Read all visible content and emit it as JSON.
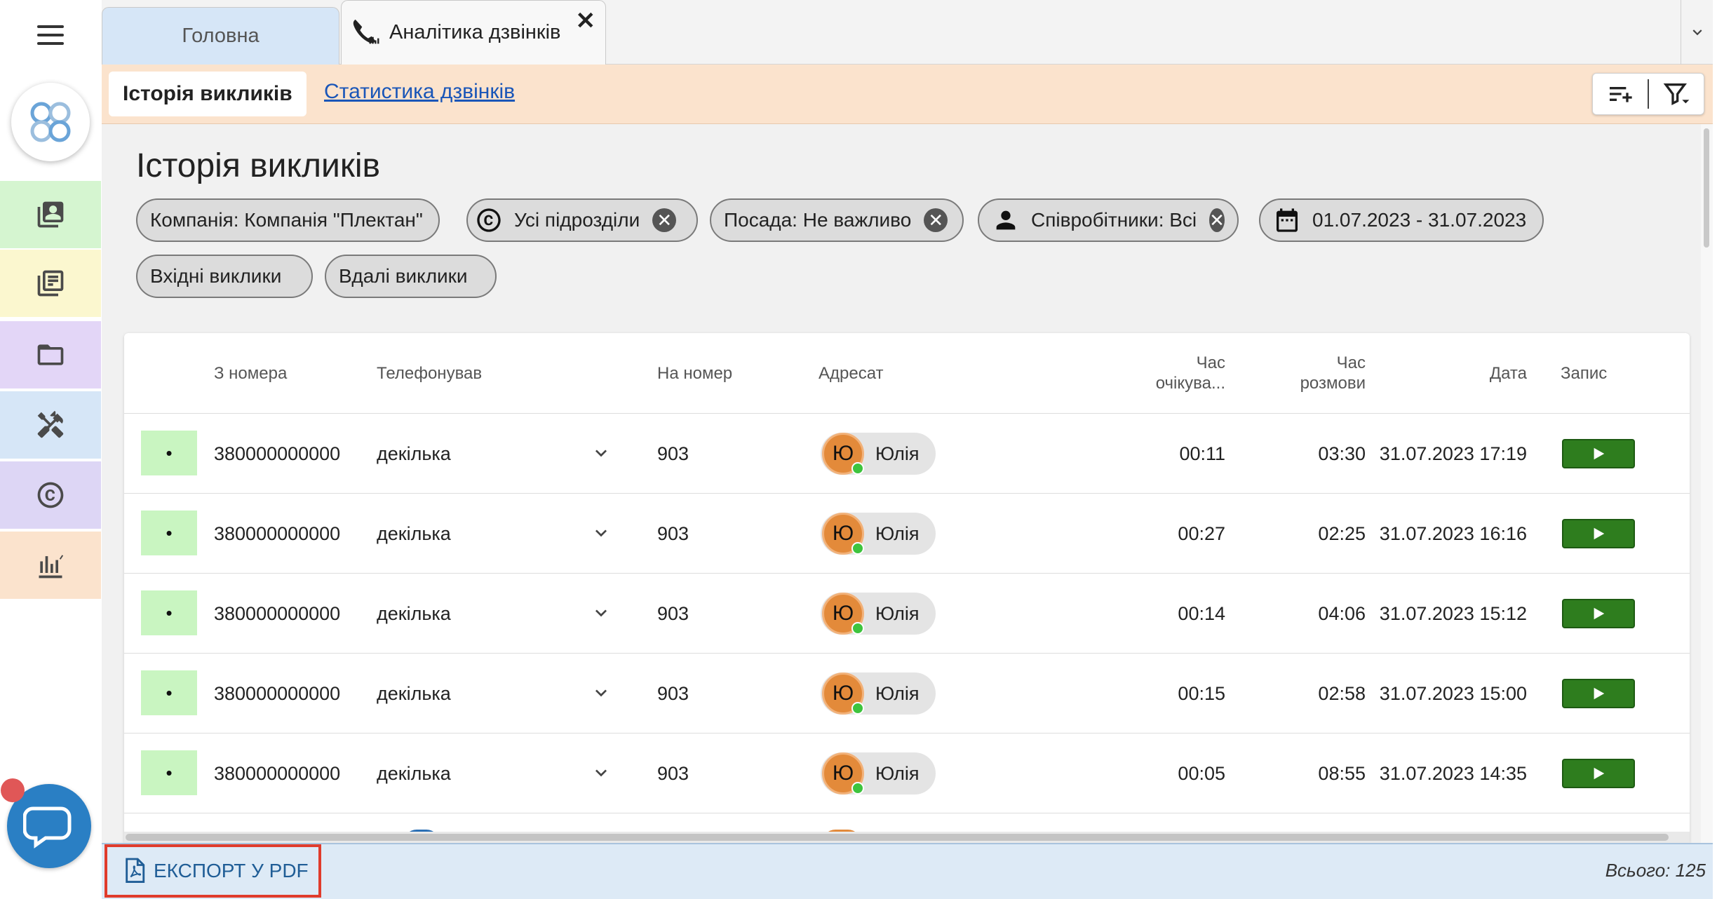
{
  "tabs": {
    "home_label": "Головна",
    "active_label": "Аналітика дзвінків",
    "close_symbol": "✕"
  },
  "subnav": {
    "active_label": "Історія викликів",
    "link_label": "Статистика дзвінків"
  },
  "page": {
    "title": "Історія викликів"
  },
  "chips": {
    "company": "Компанія: Компанія \"Плектан\"",
    "departments": "Усі підрозділи",
    "position": "Посада: Не важливо",
    "employees": "Співробітники: Всі",
    "date_range": "01.07.2023 - 31.07.2023",
    "incoming": "Вхідні виклики",
    "successful": "Вдалі виклики",
    "clear_symbol": "✕"
  },
  "table": {
    "headers": {
      "from_number": "З номера",
      "caller": "Телефонував",
      "to_number": "На номер",
      "addressee": "Адресат",
      "wait_time_line1": "Час",
      "wait_time_line2": "очікува...",
      "talk_time_line1": "Час",
      "talk_time_line2": "розмови",
      "date": "Дата",
      "record": "Запис"
    },
    "rows": [
      {
        "status": "•",
        "from": "380000000000",
        "caller": "декілька",
        "to": "903",
        "avatar": "Ю",
        "addressee": "Юлія",
        "wait": "00:11",
        "talk": "03:30",
        "date": "31.07.2023 17:19"
      },
      {
        "status": "•",
        "from": "380000000000",
        "caller": "декілька",
        "to": "903",
        "avatar": "Ю",
        "addressee": "Юлія",
        "wait": "00:27",
        "talk": "02:25",
        "date": "31.07.2023 16:16"
      },
      {
        "status": "•",
        "from": "380000000000",
        "caller": "декілька",
        "to": "903",
        "avatar": "Ю",
        "addressee": "Юлія",
        "wait": "00:14",
        "talk": "04:06",
        "date": "31.07.2023 15:12"
      },
      {
        "status": "•",
        "from": "380000000000",
        "caller": "декілька",
        "to": "903",
        "avatar": "Ю",
        "addressee": "Юлія",
        "wait": "00:15",
        "talk": "02:58",
        "date": "31.07.2023 15:00"
      },
      {
        "status": "•",
        "from": "380000000000",
        "caller": "декілька",
        "to": "903",
        "avatar": "Ю",
        "addressee": "Юлія",
        "wait": "00:05",
        "talk": "08:55",
        "date": "31.07.2023 14:35"
      }
    ]
  },
  "footer": {
    "export_label": "ЕКСПОРТ У PDF",
    "total": "Всього: 125"
  },
  "sidebar": {
    "items": [
      {
        "name": "contacts-icon",
        "bg": "#d5f5d0"
      },
      {
        "name": "news-icon",
        "bg": "#fbf7cf"
      },
      {
        "name": "folder-icon",
        "bg": "#e3d6f7"
      },
      {
        "name": "tools-icon",
        "bg": "#d6e6f7"
      },
      {
        "name": "copyright-icon",
        "bg": "#ddd6f5"
      },
      {
        "name": "analytics-icon",
        "bg": "#fbe3cd"
      }
    ]
  },
  "colors": {
    "subnav_bg": "#fbe3cd",
    "home_tab_bg": "#d6e6f7",
    "status_green": "#c9f5c1",
    "play_green": "#2e7d1e",
    "avatar_orange": "#e38a3a",
    "export_highlight": "#e03c2c",
    "link_blue": "#1a56b8"
  }
}
